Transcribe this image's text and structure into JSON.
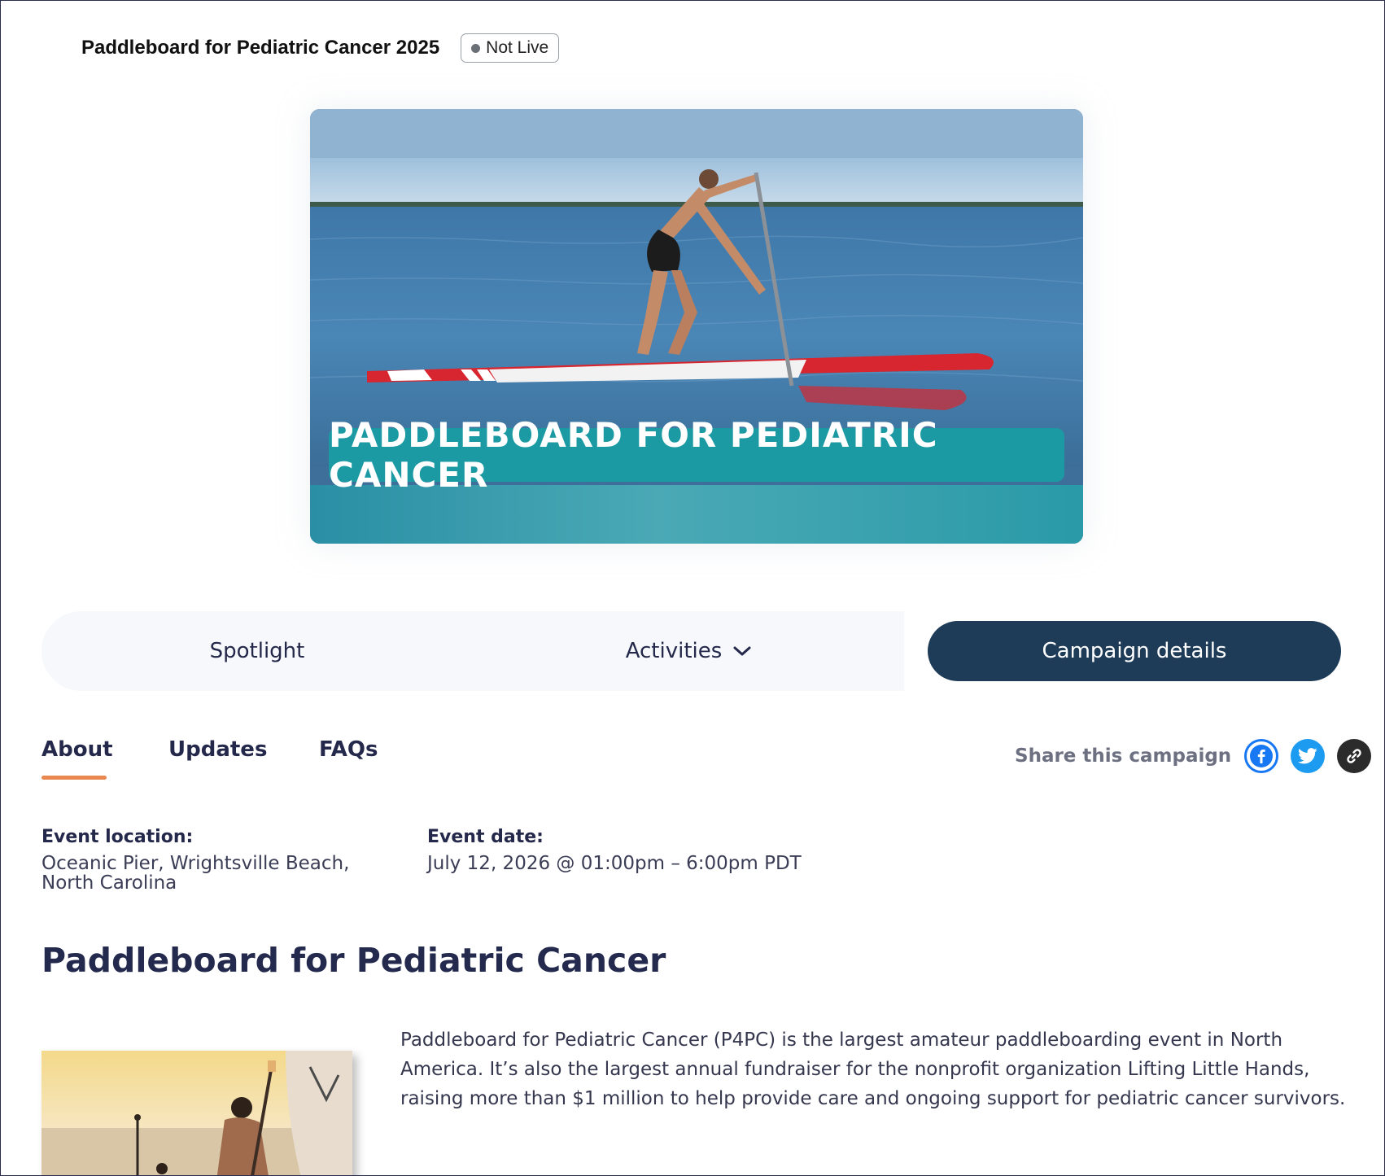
{
  "header": {
    "campaign_title": "Paddleboard for Pediatric Cancer 2025",
    "status": "Not Live"
  },
  "hero": {
    "banner_text": "PADDLEBOARD FOR PEDIATRIC CANCER"
  },
  "nav": {
    "spotlight": "Spotlight",
    "activities": "Activities",
    "campaign_details": "Campaign details"
  },
  "tabs": {
    "about": "About",
    "updates": "Updates",
    "faqs": "FAQs"
  },
  "share": {
    "label": "Share this campaign",
    "icons": [
      "facebook-icon",
      "twitter-icon",
      "link-icon"
    ]
  },
  "event": {
    "location_label": "Event location:",
    "location_value": "Oceanic Pier, Wrightsville Beach, North Carolina",
    "date_label": "Event date:",
    "date_value": "July 12, 2026 @ 01:00pm – 6:00pm PDT"
  },
  "story": {
    "heading": "Paddleboard for Pediatric Cancer",
    "paragraph": "Paddleboard for Pediatric Cancer (P4PC) is the largest amateur paddleboarding event in North America. It’s also the largest annual fundraiser for the nonprofit organization Lifting Little Hands, raising more than $1 million to help provide care and ongoing support for pediatric cancer survivors."
  },
  "colors": {
    "primary_dark": "#1e3c58",
    "tab_underline": "#e8874f",
    "facebook": "#1877f2",
    "twitter": "#1d9bf0",
    "banner": "#1c9aa3"
  }
}
